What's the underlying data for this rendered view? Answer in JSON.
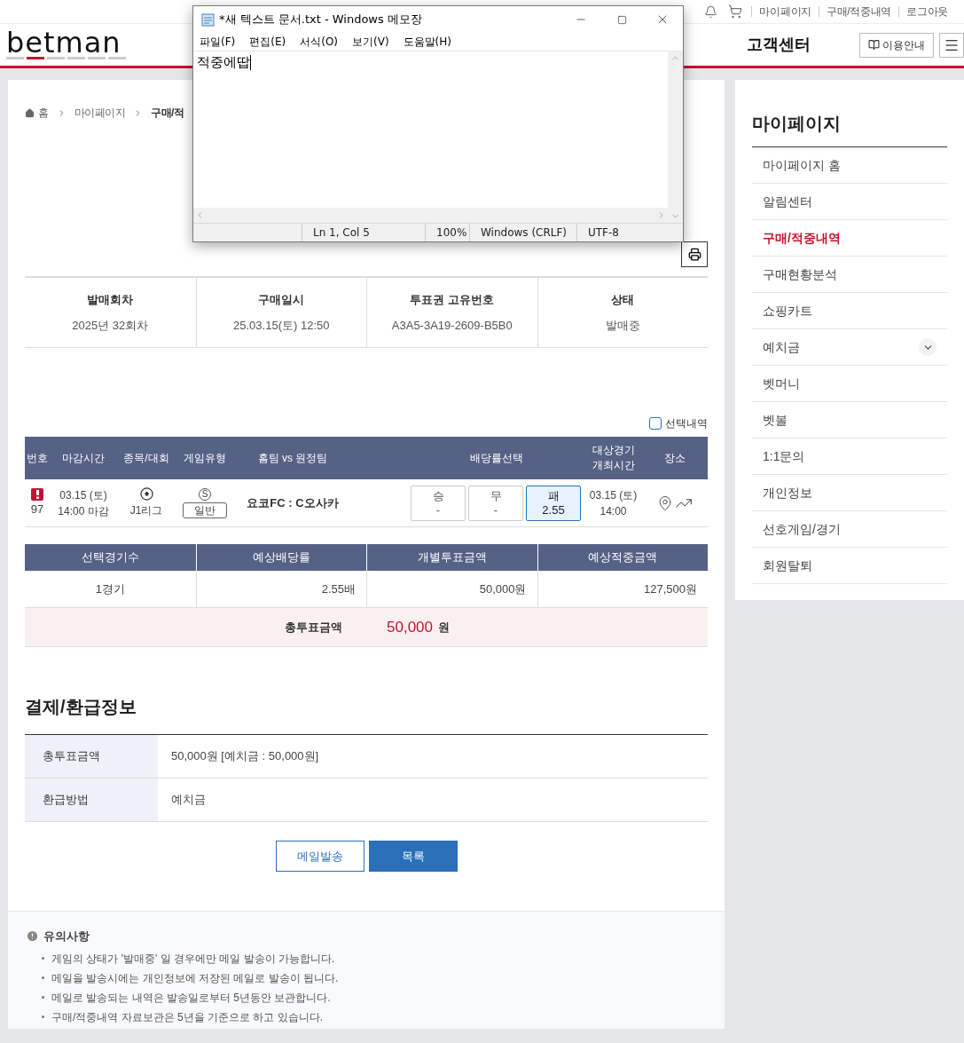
{
  "top_bar": {
    "links": [
      "마이페이지",
      "구매/적중내역",
      "로그아웃"
    ]
  },
  "header": {
    "logo": "betman",
    "center_link": "고객센터",
    "guide_button": "이용안내"
  },
  "breadcrumb": [
    "홈",
    "마이페이지",
    "구매/적"
  ],
  "summary": [
    {
      "label": "발매회차",
      "value": "2025년 32회차"
    },
    {
      "label": "구매일시",
      "value": "25.03.15(토) 12:50"
    },
    {
      "label": "투표권 고유번호",
      "value": "A3A5-3A19-2609-B5B0"
    },
    {
      "label": "상태",
      "value": "발매중"
    }
  ],
  "selection_toggle": {
    "label": "선택내역",
    "checked": false
  },
  "game_table": {
    "columns": [
      "번호",
      "마감시간",
      "종목/대회",
      "게임유형",
      "홈팀 vs 원정팀",
      "배당률선택",
      "대상경기\n개최시간",
      "장소"
    ],
    "rows": [
      {
        "number": "97",
        "warning": true,
        "deadline": [
          "03.15 (토)",
          "14:00 마감"
        ],
        "league": "J1리그",
        "type_badge": "S",
        "type": "일반",
        "match": "요코FC : C오사카",
        "options": [
          {
            "label": "승",
            "odds": "-",
            "selected": false
          },
          {
            "label": "무",
            "odds": "-",
            "selected": false
          },
          {
            "label": "패",
            "odds": "2.55",
            "selected": true
          }
        ],
        "time": [
          "03.15 (토)",
          "14:00"
        ]
      }
    ]
  },
  "totals": {
    "columns": [
      "선택경기수",
      "예상배당률",
      "개별투표금액",
      "예상적중금액"
    ],
    "values": [
      "1경기",
      "2.55배",
      "50,000원",
      "127,500원"
    ],
    "total_label": "총투표금액",
    "total_amount": "50,000",
    "total_unit": "원"
  },
  "payment": {
    "title": "결제/환급정보",
    "rows": [
      {
        "label": "총투표금액",
        "value": "50,000원 [예치금 : 50,000원]"
      },
      {
        "label": "환급방법",
        "value": "예치금"
      }
    ]
  },
  "buttons": [
    {
      "label": "메일발송",
      "kind": "outline"
    },
    {
      "label": "목록",
      "kind": "primary"
    }
  ],
  "notes": {
    "title": "유의사항",
    "items": [
      "게임의 상태가 '발매중' 일 경우에만 메일 발송이 가능합니다.",
      "메일을 발송시에는 개인정보에 저장된 메일로 발송이 됩니다.",
      "메일로 발송되는 내역은 발송일로부터 5년동안 보관합니다.",
      "구매/적중내역 자료보관은 5년을 기준으로 하고 있습니다."
    ]
  },
  "sidebar": {
    "title": "마이페이지",
    "items": [
      {
        "label": "마이페이지 홈",
        "selected": false
      },
      {
        "label": "알림센터",
        "selected": false
      },
      {
        "label": "구매/적중내역",
        "selected": true
      },
      {
        "label": "구매현황분석",
        "selected": false
      },
      {
        "label": "쇼핑카트",
        "selected": false
      },
      {
        "label": "예치금",
        "selected": false,
        "expanded": false
      },
      {
        "label": "벳머니",
        "selected": false
      },
      {
        "label": "벳볼",
        "selected": false
      },
      {
        "label": "1:1문의",
        "selected": false
      },
      {
        "label": "개인정보",
        "selected": false
      },
      {
        "label": "선호게임/경기",
        "selected": false
      },
      {
        "label": "회원탈퇴",
        "selected": false
      }
    ]
  },
  "notepad": {
    "title": "*새 텍스트 문서.txt - Windows 메모장",
    "menu": [
      "파일(F)",
      "편집(E)",
      "서식(O)",
      "보기(V)",
      "도움말(H)"
    ],
    "text": "적중에땁",
    "status": [
      "Ln 1, Col 5",
      "100%",
      "Windows (CRLF)",
      "UTF-8"
    ]
  }
}
